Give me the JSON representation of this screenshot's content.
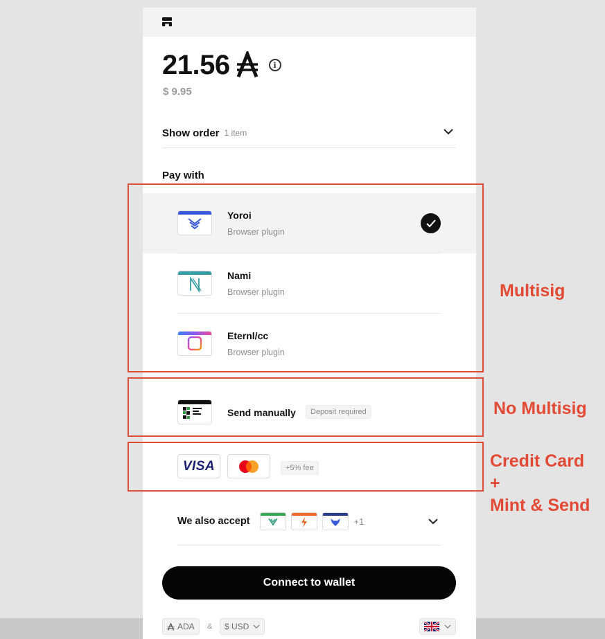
{
  "checkout": {
    "amount": "21.56",
    "fiat_amount": "$ 9.95",
    "info_icon": "info-icon",
    "order": {
      "label": "Show order",
      "count": "1 item"
    },
    "pay_with_label": "Pay with",
    "wallets": [
      {
        "name": "Yoroi",
        "subtitle": "Browser plugin",
        "selected": true,
        "accent": "#3a5bd9"
      },
      {
        "name": "Nami",
        "subtitle": "Browser plugin",
        "selected": false,
        "accent": "#349ea3"
      },
      {
        "name": "Eternl/cc",
        "subtitle": "Browser plugin",
        "selected": false,
        "accent": "#8b5cf6"
      }
    ],
    "manual": {
      "name": "Send manually",
      "badge": "Deposit required"
    },
    "cards": {
      "visa": "VISA",
      "mastercard_icon": "mastercard-logo",
      "fee_badge": "+5% fee"
    },
    "also_accept": {
      "label": "We also accept",
      "more": "+1"
    },
    "connect_button": "Connect to wallet",
    "footer": {
      "currency": "ADA",
      "ampersand": "&",
      "fiat_currency": "$ USD",
      "language_icon": "uk-flag-icon"
    }
  },
  "annotations": [
    {
      "label": "Multisig"
    },
    {
      "label": "No Multisig"
    },
    {
      "label": "Credit Card\n+\nMint & Send"
    }
  ],
  "colors": {
    "annotation": "#e24a35",
    "button": "#050505",
    "selected_row": "#f3f3f3"
  }
}
